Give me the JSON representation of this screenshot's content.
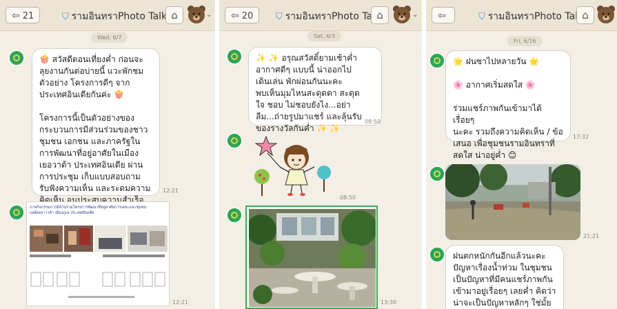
{
  "colors": {
    "background": "#f3efe6",
    "header": "#ece5d6",
    "bubble": "#ffffff",
    "avatar": "#2aa55a"
  },
  "panels": [
    {
      "back_count": "21",
      "title": "รามอินทราPhoto Talk",
      "date": "Wed, 6/7",
      "messages": [
        {
          "text": "🍿 สวัสดีตอนเที่ยงค่ำ ก่อนจะ\nลุยงานกันต่อบ่ายนี้ แวะพักชม\nตัวอย่าง โครงการดีๆ จาก\nประเทศอินเดียกันค่ะ 🍿\n\nโครงการนี้เป็นตัวอย่างของ\nกระบวนการมีส่วนร่วมของชาว\nชุมชน เอกชน และภาครัฐใน\nการพัฒนาที่อยู่อาศัยในเมือง\nเยอวาด้า ประเทศอินเดีย ผ่าน\nการประชุม เก็บแบบสอบถาม\nรับฟังความเห็น และระดมความ\nคิดเห็น จนประสบความสำเร็จ",
          "time": "12:21"
        },
        {
          "image_caption": "ภาพกิจกรรมการมีส่วนร่วมโครงการพัฒนาที่อยู่อาศัยการเคหะและชุมชน\nแอดิดเยาวาด้า เมืองภูเน่ ประเทศอินเดีย",
          "time": "12:21"
        }
      ]
    },
    {
      "back_count": "20",
      "title": "รามอินทราPhoto Talk",
      "date": "Sat, 6/3",
      "messages": [
        {
          "text": "✨ ✨ อรุณสวัสดิ์ยามเช้าค่ำ\nอากาศดีๆ แบบนี้ น่าออกไป\nเดินเล่น พักผ่อนกันนะคะ\nพบเห็นมุมไหนสะดุดตา สะดุด\nใจ ชอบ ไม่ชอบยังไง...อย่า\nลืม...ถ่ายรูปมาแชร์ และลุ้นรับ\nของรางวัลกันค่ำ ✨ ✨",
          "time": "08:50"
        },
        {
          "sticker": "girl-with-star-sticker",
          "time": "08:50"
        },
        {
          "image": "garden-cafe-photo",
          "time": "13:30"
        }
      ]
    },
    {
      "back_count": "",
      "title": "รามอินทราPhoto Talk",
      "date": "Fri, 6/16",
      "messages": [
        {
          "text": "🌟 ฝนซาไปหลายวัน 🌟\n\n🌸 อากาศเริ่มสดใส 🌸\n\nร่วมแชร์ภาพกันเข้ามาได้เรื่อยๆ\nนะคะ รวมถึงความคิดเห็น / ข้อ\nเสนอ เพื่อชุมชนรามอินทราที่\nสดใส น่าอยู่ค่ำ 😊",
          "time": "17:32"
        },
        {
          "image": "flooded-street-photo",
          "time": "21:21"
        },
        {
          "text": "ฝนตกหนักกันอีกแล้วนะคะ\nปัญหาเรื่องน้ำท่วม ในชุมชน\nเป็นปัญหาที่มีคนแชร์ภาพกัน\nเข้ามาอยู่เรื่อยๆ เลยค่ำ คิดว่า\nน่าจะเป็นปัญหาหลักๆ ใช่มั้ย\nคะ?",
          "time": ""
        }
      ]
    }
  ]
}
